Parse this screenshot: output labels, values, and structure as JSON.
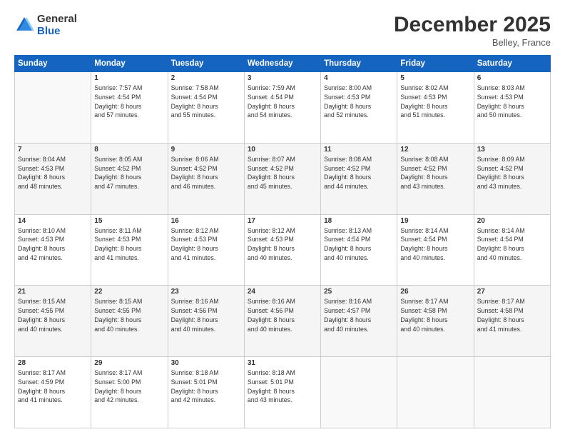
{
  "header": {
    "logo_general": "General",
    "logo_blue": "Blue",
    "month": "December 2025",
    "location": "Belley, France"
  },
  "days": [
    "Sunday",
    "Monday",
    "Tuesday",
    "Wednesday",
    "Thursday",
    "Friday",
    "Saturday"
  ],
  "weeks": [
    [
      {
        "day": "",
        "info": ""
      },
      {
        "day": "1",
        "info": "Sunrise: 7:57 AM\nSunset: 4:54 PM\nDaylight: 8 hours\nand 57 minutes."
      },
      {
        "day": "2",
        "info": "Sunrise: 7:58 AM\nSunset: 4:54 PM\nDaylight: 8 hours\nand 55 minutes."
      },
      {
        "day": "3",
        "info": "Sunrise: 7:59 AM\nSunset: 4:54 PM\nDaylight: 8 hours\nand 54 minutes."
      },
      {
        "day": "4",
        "info": "Sunrise: 8:00 AM\nSunset: 4:53 PM\nDaylight: 8 hours\nand 52 minutes."
      },
      {
        "day": "5",
        "info": "Sunrise: 8:02 AM\nSunset: 4:53 PM\nDaylight: 8 hours\nand 51 minutes."
      },
      {
        "day": "6",
        "info": "Sunrise: 8:03 AM\nSunset: 4:53 PM\nDaylight: 8 hours\nand 50 minutes."
      }
    ],
    [
      {
        "day": "7",
        "info": "Sunrise: 8:04 AM\nSunset: 4:53 PM\nDaylight: 8 hours\nand 48 minutes."
      },
      {
        "day": "8",
        "info": "Sunrise: 8:05 AM\nSunset: 4:52 PM\nDaylight: 8 hours\nand 47 minutes."
      },
      {
        "day": "9",
        "info": "Sunrise: 8:06 AM\nSunset: 4:52 PM\nDaylight: 8 hours\nand 46 minutes."
      },
      {
        "day": "10",
        "info": "Sunrise: 8:07 AM\nSunset: 4:52 PM\nDaylight: 8 hours\nand 45 minutes."
      },
      {
        "day": "11",
        "info": "Sunrise: 8:08 AM\nSunset: 4:52 PM\nDaylight: 8 hours\nand 44 minutes."
      },
      {
        "day": "12",
        "info": "Sunrise: 8:08 AM\nSunset: 4:52 PM\nDaylight: 8 hours\nand 43 minutes."
      },
      {
        "day": "13",
        "info": "Sunrise: 8:09 AM\nSunset: 4:52 PM\nDaylight: 8 hours\nand 43 minutes."
      }
    ],
    [
      {
        "day": "14",
        "info": "Sunrise: 8:10 AM\nSunset: 4:53 PM\nDaylight: 8 hours\nand 42 minutes."
      },
      {
        "day": "15",
        "info": "Sunrise: 8:11 AM\nSunset: 4:53 PM\nDaylight: 8 hours\nand 41 minutes."
      },
      {
        "day": "16",
        "info": "Sunrise: 8:12 AM\nSunset: 4:53 PM\nDaylight: 8 hours\nand 41 minutes."
      },
      {
        "day": "17",
        "info": "Sunrise: 8:12 AM\nSunset: 4:53 PM\nDaylight: 8 hours\nand 40 minutes."
      },
      {
        "day": "18",
        "info": "Sunrise: 8:13 AM\nSunset: 4:54 PM\nDaylight: 8 hours\nand 40 minutes."
      },
      {
        "day": "19",
        "info": "Sunrise: 8:14 AM\nSunset: 4:54 PM\nDaylight: 8 hours\nand 40 minutes."
      },
      {
        "day": "20",
        "info": "Sunrise: 8:14 AM\nSunset: 4:54 PM\nDaylight: 8 hours\nand 40 minutes."
      }
    ],
    [
      {
        "day": "21",
        "info": "Sunrise: 8:15 AM\nSunset: 4:55 PM\nDaylight: 8 hours\nand 40 minutes."
      },
      {
        "day": "22",
        "info": "Sunrise: 8:15 AM\nSunset: 4:55 PM\nDaylight: 8 hours\nand 40 minutes."
      },
      {
        "day": "23",
        "info": "Sunrise: 8:16 AM\nSunset: 4:56 PM\nDaylight: 8 hours\nand 40 minutes."
      },
      {
        "day": "24",
        "info": "Sunrise: 8:16 AM\nSunset: 4:56 PM\nDaylight: 8 hours\nand 40 minutes."
      },
      {
        "day": "25",
        "info": "Sunrise: 8:16 AM\nSunset: 4:57 PM\nDaylight: 8 hours\nand 40 minutes."
      },
      {
        "day": "26",
        "info": "Sunrise: 8:17 AM\nSunset: 4:58 PM\nDaylight: 8 hours\nand 40 minutes."
      },
      {
        "day": "27",
        "info": "Sunrise: 8:17 AM\nSunset: 4:58 PM\nDaylight: 8 hours\nand 41 minutes."
      }
    ],
    [
      {
        "day": "28",
        "info": "Sunrise: 8:17 AM\nSunset: 4:59 PM\nDaylight: 8 hours\nand 41 minutes."
      },
      {
        "day": "29",
        "info": "Sunrise: 8:17 AM\nSunset: 5:00 PM\nDaylight: 8 hours\nand 42 minutes."
      },
      {
        "day": "30",
        "info": "Sunrise: 8:18 AM\nSunset: 5:01 PM\nDaylight: 8 hours\nand 42 minutes."
      },
      {
        "day": "31",
        "info": "Sunrise: 8:18 AM\nSunset: 5:01 PM\nDaylight: 8 hours\nand 43 minutes."
      },
      {
        "day": "",
        "info": ""
      },
      {
        "day": "",
        "info": ""
      },
      {
        "day": "",
        "info": ""
      }
    ]
  ]
}
